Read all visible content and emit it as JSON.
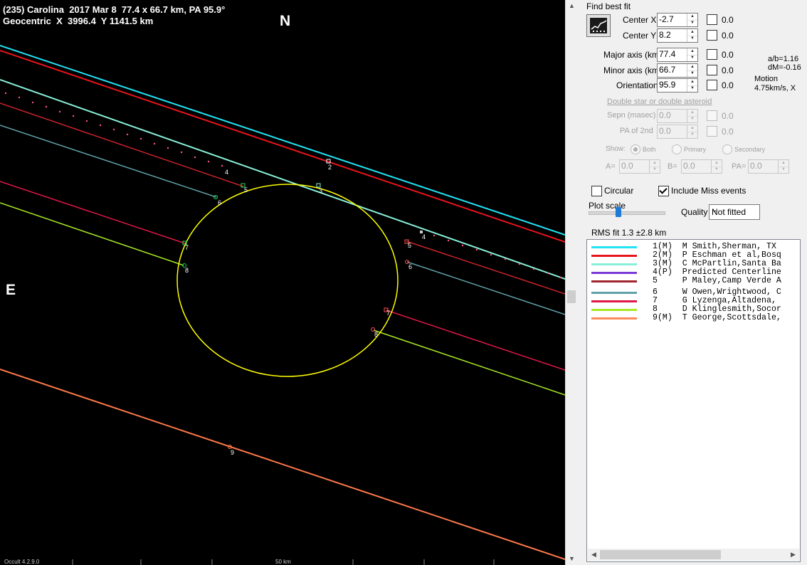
{
  "plot": {
    "header_line1": "(235) Carolina  2017 Mar 8  77.4 x 66.7 km, PA 95.9°",
    "header_line2": "Geocentric  X  3996.4  Y 1141.5 km",
    "north": "N",
    "east": "E",
    "version": "Occult 4.2.9.0",
    "scale_label": "50 km",
    "chord_labels": [
      "2",
      "3",
      "4",
      "5",
      "6",
      "7",
      "8",
      "9",
      "4",
      "5",
      "6",
      "7",
      "8"
    ],
    "colors": {
      "ellipse": "#ffff00",
      "c1": "#22e3f5",
      "c2": "#e8141c",
      "c3": "#88f0d8",
      "c4": "#ff5588",
      "c5": "#c8242c",
      "c6": "#5fa0a8",
      "c7": "#e01845",
      "c8": "#a8e825",
      "c9": "#ff7a4a"
    }
  },
  "panel": {
    "find_best_fit": "Find best fit",
    "fit_icon": "chart-fit-icon",
    "center_x": {
      "label": "Center X",
      "value": "-2.7",
      "delta": "0.0"
    },
    "center_y": {
      "label": "Center Y",
      "value": "8.2",
      "delta": "0.0"
    },
    "major_axis": {
      "label": "Major axis (km)",
      "value": "77.4",
      "delta": "0.0"
    },
    "minor_axis": {
      "label": "Minor axis (km)",
      "value": "66.7",
      "delta": "0.0"
    },
    "orientation": {
      "label": "Orientation",
      "value": "95.9",
      "delta": "0.0"
    },
    "ab_ratio": "a/b=1.16",
    "dm": "dM=-0.16",
    "motion_label": "Motion",
    "motion_value": "4.75km/s, X",
    "double_star_link": "Double star  or  double asteroid",
    "sepn": {
      "label": "Sepn (masec)",
      "value": "0.0",
      "delta": "0.0"
    },
    "pa2": {
      "label": "PA of 2nd",
      "value": "0.0",
      "delta": "0.0"
    },
    "show_label": "Show:",
    "show_options": [
      "Both",
      "Primary",
      "Secondary"
    ],
    "a_label": "A=",
    "a_value": "0.0",
    "b_label": "B=",
    "b_value": "0.0",
    "pa_label": "PA=",
    "pa_value": "0.0",
    "circular_label": "Circular",
    "circular_checked": false,
    "include_miss_label": "Include Miss events",
    "include_miss_checked": true,
    "plot_scale_label": "Plot scale",
    "plot_scale_level": 0.36,
    "quality_label": "Quality",
    "quality_value": "Not fitted",
    "rms_fit": "RMS fit  1.3 ±2.8 km",
    "legend": [
      {
        "text": "1(M)  M Smith,Sherman, TX",
        "color": "#22e3f5"
      },
      {
        "text": "2(M)  P Eschman et al,Bosq",
        "color": "#e8141c"
      },
      {
        "text": "3(M)  C McPartlin,Santa Ba",
        "color": "#88f0d8"
      },
      {
        "text": "4(P)  Predicted Centerline",
        "color": "#7b3ad6"
      },
      {
        "text": "5     P Maley,Camp Verde A",
        "color": "#a0242c"
      },
      {
        "text": "6     W Owen,Wrightwood, C",
        "color": "#5fa0a8"
      },
      {
        "text": "7     G Lyzenga,Altadena,",
        "color": "#e01845"
      },
      {
        "text": "8     D Klinglesmith,Socor",
        "color": "#a8e825"
      },
      {
        "text": "9(M)  T George,Scottsdale,",
        "color": "#ff8a5a"
      }
    ]
  }
}
